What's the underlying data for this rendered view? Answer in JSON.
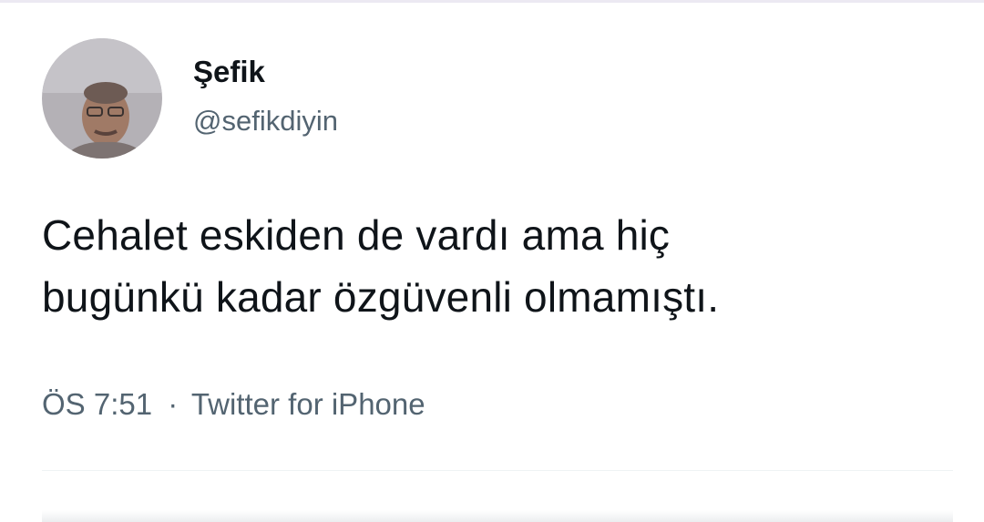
{
  "user": {
    "display_name": "Şefik",
    "handle": "@sefikdiyin"
  },
  "tweet": {
    "text_line_1": "Cehalet eskiden de vardı ama hiç",
    "text_line_2": "bugünkü kadar özgüvenli olmamıştı."
  },
  "meta": {
    "time": "ÖS 7:51",
    "separator": "·",
    "source": "Twitter for iPhone"
  },
  "colors": {
    "text_primary": "#0f1419",
    "text_secondary": "#536471",
    "divider": "#eff3f4"
  }
}
